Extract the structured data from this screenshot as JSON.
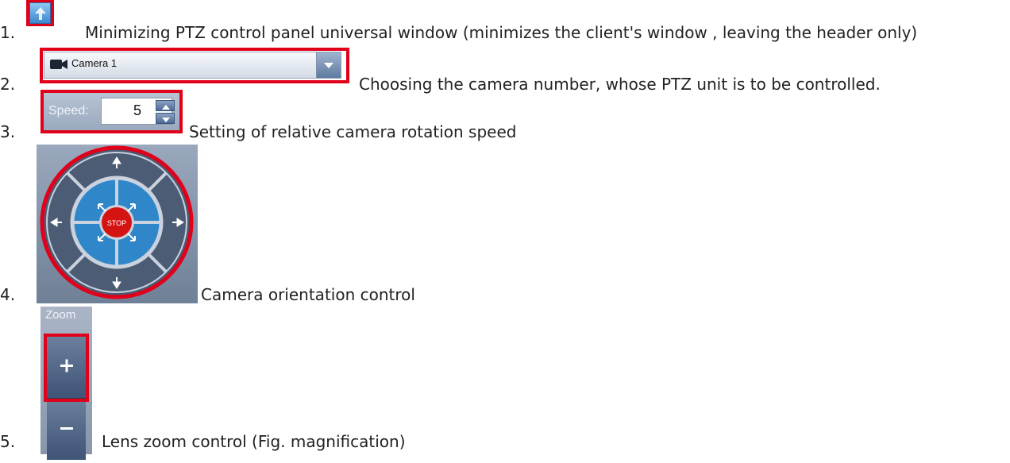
{
  "items": [
    {
      "number": "1.",
      "text": "Minimizing PTZ control panel universal window (minimizes the client's window , leaving the header only)"
    },
    {
      "number": "2.",
      "text": "Choosing the camera number, whose PTZ unit is to be controlled."
    },
    {
      "number": "3.",
      "text": "Setting of relative camera rotation speed"
    },
    {
      "number": "4.",
      "text": "Camera orientation control"
    },
    {
      "number": "5.",
      "text": "Lens zoom control (Fig. magnification)"
    }
  ],
  "camera_select": {
    "value": "Camera 1"
  },
  "speed_control": {
    "label": "Speed:",
    "value": "5"
  },
  "ptz_control": {
    "stop_label": "STOP"
  },
  "zoom_control": {
    "label": "Zoom"
  },
  "colors": {
    "highlight": "#e0001a",
    "panel": "#8c9bb1",
    "stop": "#d41313",
    "ring": "#3a8fd0"
  }
}
